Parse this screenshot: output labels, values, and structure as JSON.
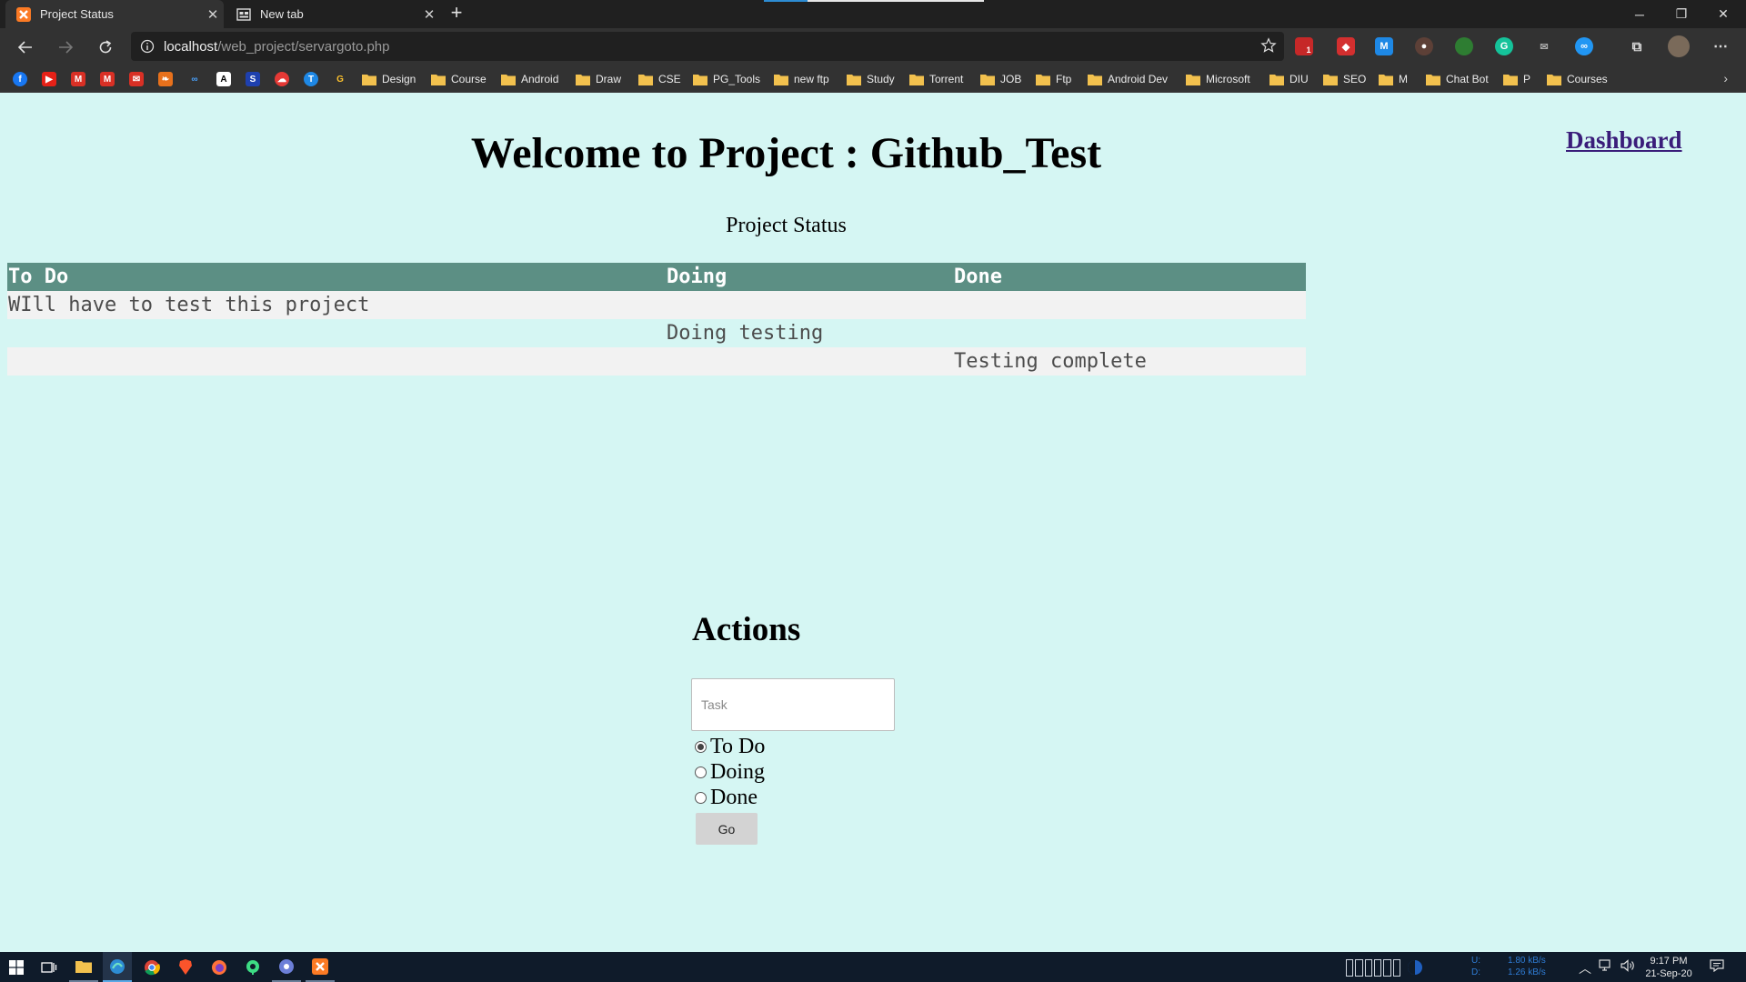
{
  "browser": {
    "tabs": [
      {
        "title": "Project Status",
        "active": true
      },
      {
        "title": "New tab",
        "active": false
      }
    ],
    "address": {
      "host": "localhost",
      "path": "/web_project/servargoto.php"
    },
    "bookmark_folders": [
      "Design",
      "Course",
      "Android",
      "Draw",
      "CSE",
      "PG_Tools",
      "new ftp",
      "Study",
      "Torrent",
      "JOB",
      "Ftp",
      "Android Dev",
      "Microsoft",
      "DIU",
      "SEO",
      "M",
      "Chat Bot",
      "P",
      "Courses"
    ],
    "extension_badge": "1",
    "colors": {
      "tabstrip": "#202020",
      "toolbar": "#323232",
      "accent": "#2d8cd3"
    }
  },
  "page": {
    "dashboard_link": "Dashboard",
    "title": "Welcome to Project : Github_Test",
    "subtitle": "Project Status",
    "table": {
      "headers": [
        "To Do",
        "Doing",
        "Done"
      ],
      "rows": [
        [
          "WIll have to test this project",
          "",
          ""
        ],
        [
          "",
          "Doing testing",
          ""
        ],
        [
          "",
          "",
          "Testing complete"
        ]
      ]
    },
    "actions": {
      "heading": "Actions",
      "task_placeholder": "Task",
      "task_value": "",
      "options": [
        "To Do",
        "Doing",
        "Done"
      ],
      "selected": "To Do",
      "go_label": "Go"
    },
    "colors": {
      "background": "#d5f6f3",
      "table_header": "#5c8f84",
      "link": "#3a1d7a"
    }
  },
  "taskbar": {
    "net_upload_label": "U:",
    "net_upload": "1.80 kB/s",
    "net_download_label": "D:",
    "net_download": "1.26 kB/s",
    "time": "9:17 PM",
    "date": "21-Sep-20"
  }
}
